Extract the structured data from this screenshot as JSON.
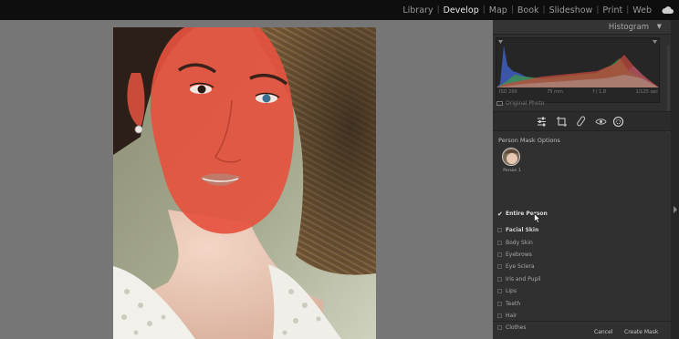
{
  "app": {
    "modules": [
      "Library",
      "Develop",
      "Map",
      "Book",
      "Slideshow",
      "Print",
      "Web"
    ],
    "active_module": "Develop"
  },
  "histogram": {
    "title": "Histogram",
    "iso": "ISO 200",
    "focal": "75 mm",
    "aperture": "f / 1.8",
    "shutter": "1/125 sec",
    "original_photo": "Original Photo"
  },
  "mask_options": {
    "title": "Person Mask Options",
    "person_label": "Person 1",
    "entire_person": "Entire Person",
    "items": [
      "Facial Skin",
      "Body Skin",
      "Eyebrows",
      "Eye Sclera",
      "Iris and Pupil",
      "Lips",
      "Teeth",
      "Hair",
      "Clothes"
    ],
    "cancel": "Cancel",
    "create": "Create Mask"
  },
  "colors": {
    "mask_overlay": "#e5533f",
    "panel_bg": "#2f2f2f",
    "canvas_bg": "#767676"
  }
}
